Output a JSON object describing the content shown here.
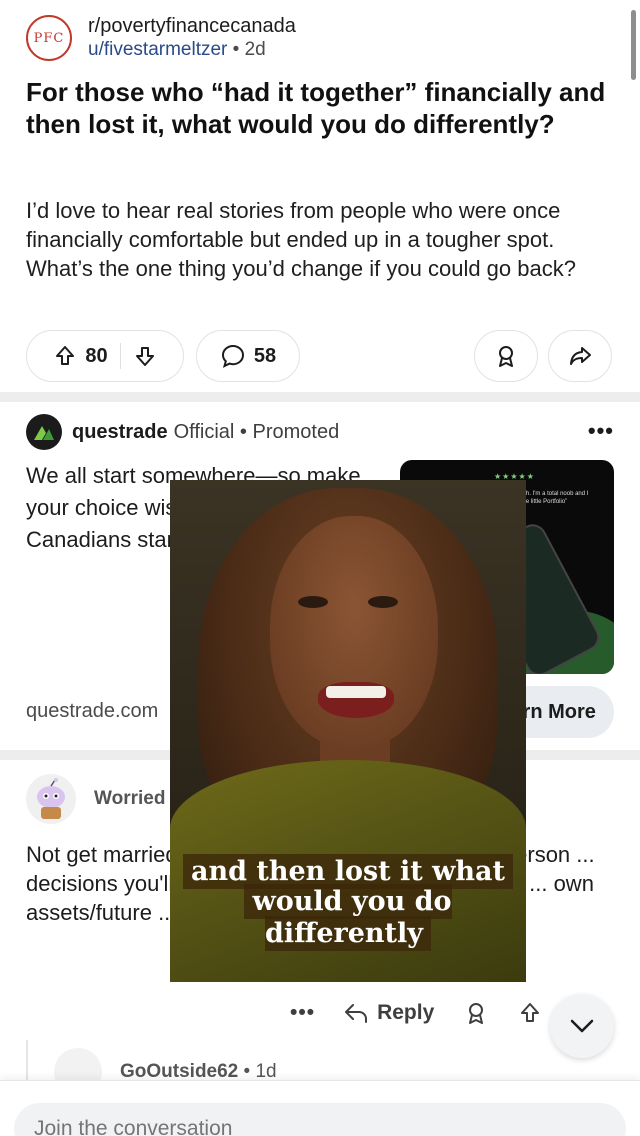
{
  "post": {
    "sub_avatar_text": "PFC",
    "subreddit": "r/povertyfinancecanada",
    "author": "u/fivestarmeltzer",
    "age": "2d",
    "title": "For those who “had it together” financially and then lost it, what would you do differently?",
    "body": "I’d love to hear real stories from people who were once financially comfortable but ended up in a tougher spot. What’s the one thing you’d change if you could go back?",
    "upvotes": "80",
    "comments": "58"
  },
  "ad": {
    "name": "questrade",
    "official": "Official",
    "promoted": "Promoted",
    "text": "We all start somewhere—so make your choice wisely. See why other Canadians start with Questrade.",
    "image_quote": "“Great app to get into stocks with. I'm a total noob and I have made myself a nice little Portfolio”",
    "domain": "questrade.com",
    "cta": "Learn More",
    "more": "•••"
  },
  "comment": {
    "author": "Worried",
    "text": "Not get married / make sure you have the wrong person ... decisions you'll make ... make sure you are aligned ... own assets/future ... agreement.",
    "actions": {
      "more": "•••",
      "reply": "Reply"
    }
  },
  "reply_comment": {
    "author": "GoOutside62",
    "age": "1d"
  },
  "composer": {
    "placeholder": "Join the conversation"
  },
  "video": {
    "caption_line1": "and then lost it what",
    "caption_line2": "would you do differently"
  },
  "colors": {
    "accent_red": "#c0392b",
    "pill_border": "#e2e2e2",
    "cta_bg": "#e9edf1",
    "separator": "#ededed"
  }
}
